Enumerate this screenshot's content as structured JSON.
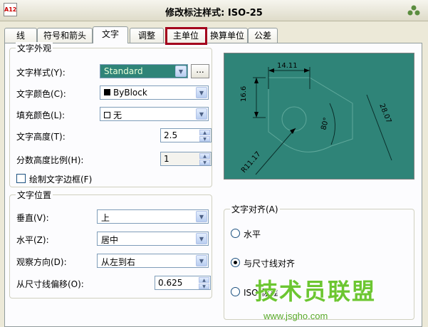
{
  "window": {
    "title": "修改标注样式: ISO-25",
    "app_icon": "A12"
  },
  "tabs": [
    {
      "label": "线"
    },
    {
      "label": "符号和箭头"
    },
    {
      "label": "文字"
    },
    {
      "label": "调整"
    },
    {
      "label": "主单位"
    },
    {
      "label": "换算单位"
    },
    {
      "label": "公差"
    }
  ],
  "text_appearance": {
    "legend": "文字外观",
    "style_label": "文字样式(Y):",
    "style_value": "Standard",
    "browse_label": "...",
    "color_label": "文字颜色(C):",
    "color_value": "ByBlock",
    "fill_label": "填充颜色(L):",
    "fill_value": "无",
    "height_label": "文字高度(T):",
    "height_value": "2.5",
    "fraction_label": "分数高度比例(H):",
    "fraction_value": "1",
    "frame_label": "绘制文字边框(F)"
  },
  "text_placement": {
    "legend": "文字位置",
    "vertical_label": "垂直(V):",
    "vertical_value": "上",
    "horizontal_label": "水平(Z):",
    "horizontal_value": "居中",
    "view_label": "观察方向(D):",
    "view_value": "从左到右",
    "offset_label": "从尺寸线偏移(O):",
    "offset_value": "0.625"
  },
  "text_alignment": {
    "legend": "文字对齐(A)",
    "options": [
      {
        "label": "水平",
        "checked": false
      },
      {
        "label": "与尺寸线对齐",
        "checked": true
      },
      {
        "label": "ISO 标准",
        "checked": false
      }
    ]
  },
  "preview": {
    "dim_top": "14.11",
    "dim_left": "16.6",
    "dim_right": "28.07",
    "dim_angle": "80°",
    "dim_radius": "R11.17"
  },
  "watermark": {
    "title": "技术员联盟",
    "url": "www.jsgho.com"
  },
  "colors": {
    "preview_bg": "#2f8478",
    "highlight": "#a3001c",
    "watermark": "#6cc631"
  }
}
